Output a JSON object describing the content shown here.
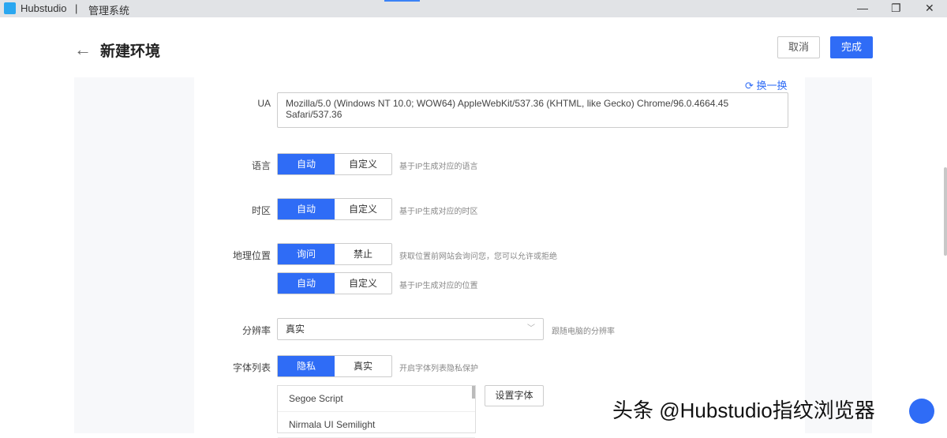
{
  "titlebar": {
    "app": "Hubstudio",
    "sep": "|",
    "system": "管理系统",
    "minimize": "—",
    "restore": "❐",
    "close": "✕"
  },
  "header": {
    "back": "←",
    "title": "新建环境",
    "cancel": "取消",
    "done": "完成"
  },
  "form": {
    "swap": "⟳ 换一换",
    "ua_label": "UA",
    "ua_value": "Mozilla/5.0 (Windows NT 10.0; WOW64) AppleWebKit/537.36 (KHTML, like Gecko) Chrome/96.0.4664.45 Safari/537.36",
    "lang_label": "语言",
    "lang_opts": [
      "自动",
      "自定义"
    ],
    "lang_hint": "基于IP生成对应的语言",
    "tz_label": "时区",
    "tz_opts": [
      "自动",
      "自定义"
    ],
    "tz_hint": "基于IP生成对应的时区",
    "geo_label": "地理位置",
    "geo_opts": [
      "询问",
      "禁止"
    ],
    "geo_hint": "获取位置前网站会询问您，您可以允许或拒绝",
    "geo2_opts": [
      "自动",
      "自定义"
    ],
    "geo2_hint": "基于IP生成对应的位置",
    "res_label": "分辨率",
    "res_value": "真实",
    "res_hint": "跟随电脑的分辨率",
    "font_label": "字体列表",
    "font_opts": [
      "隐私",
      "真实"
    ],
    "font_hint": "开启字体列表隐私保护",
    "fonts": [
      "Segoe Script",
      "Nirmala UI Semilight"
    ],
    "set_font": "设置字体"
  },
  "watermark": "头条 @Hubstudio指纹浏览器"
}
